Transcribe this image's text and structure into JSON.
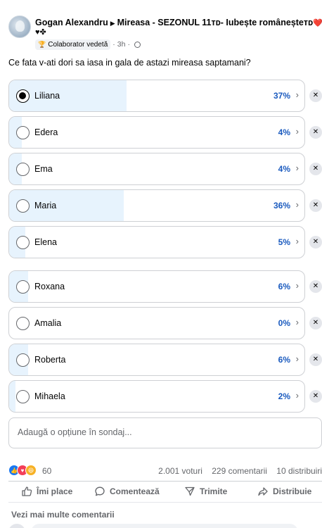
{
  "post": {
    "author": "Gogan Alexandru",
    "group": "Mireasa - SEZONUL 11тᴅ- Iubește româneșteтᴅ",
    "group_emoji": "❤️❖",
    "second_line_emoji": "♥✤",
    "badge": "Colaborator vedetă",
    "time": "3h"
  },
  "poll": {
    "question": "Ce fata v-ati dori sa iasa in gala de astazi mireasa saptamani?",
    "options": [
      {
        "label": "Liliana",
        "percent": "37%",
        "fill": 0.37,
        "selected": true
      },
      {
        "label": "Edera",
        "percent": "4%",
        "fill": 0.04,
        "selected": false
      },
      {
        "label": "Ema",
        "percent": "4%",
        "fill": 0.04,
        "selected": false
      },
      {
        "label": "Maria",
        "percent": "36%",
        "fill": 0.36,
        "selected": false
      },
      {
        "label": "Elena",
        "percent": "5%",
        "fill": 0.05,
        "selected": false
      },
      {
        "label": "Roxana",
        "percent": "6%",
        "fill": 0.06,
        "selected": false
      },
      {
        "label": "Amalia",
        "percent": "0%",
        "fill": 0.0,
        "selected": false
      },
      {
        "label": "Roberta",
        "percent": "6%",
        "fill": 0.06,
        "selected": false
      },
      {
        "label": "Mihaela",
        "percent": "2%",
        "fill": 0.02,
        "selected": false
      }
    ],
    "add_option_placeholder": "Adaugă o opțiune în sondaj..."
  },
  "stats": {
    "reactions_count": "60",
    "votes": "2.001 voturi",
    "comments": "229 comentarii",
    "shares": "10 distribuiri"
  },
  "actions": {
    "like": "Îmi place",
    "comment": "Comentează",
    "send": "Trimite",
    "share": "Distribuie"
  },
  "comments": {
    "more": "Vezi mai multe comentarii"
  },
  "colors": {
    "accent": "#1877f2",
    "fill": "#e7f3fd",
    "border": "#ced0d4",
    "muted": "#65676b"
  }
}
